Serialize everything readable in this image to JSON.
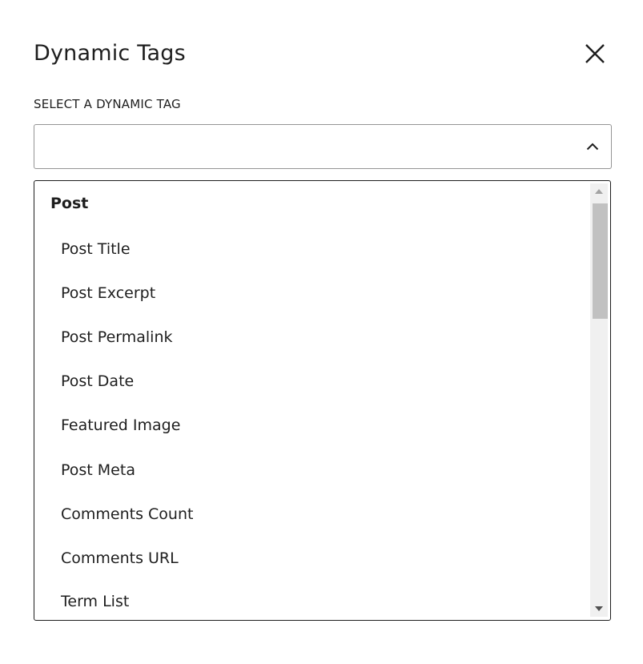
{
  "modal": {
    "title": "Dynamic Tags",
    "close_icon": "close-icon"
  },
  "select": {
    "label": "SELECT A DYNAMIC TAG",
    "value": "",
    "placeholder": "",
    "chevron_icon": "chevron-up-icon"
  },
  "listbox": {
    "group_label": "Post",
    "options": [
      "Post Title",
      "Post Excerpt",
      "Post Permalink",
      "Post Date",
      "Featured Image",
      "Post Meta",
      "Comments Count",
      "Comments URL",
      "Term List"
    ],
    "scroll_position": 0.0
  },
  "colors": {
    "text": "#1e1e1e",
    "border": "#949494",
    "listbox_border": "#1e1e1e",
    "scrollbar_track": "#f0f0f0",
    "scrollbar_thumb": "#c1c1c1"
  }
}
